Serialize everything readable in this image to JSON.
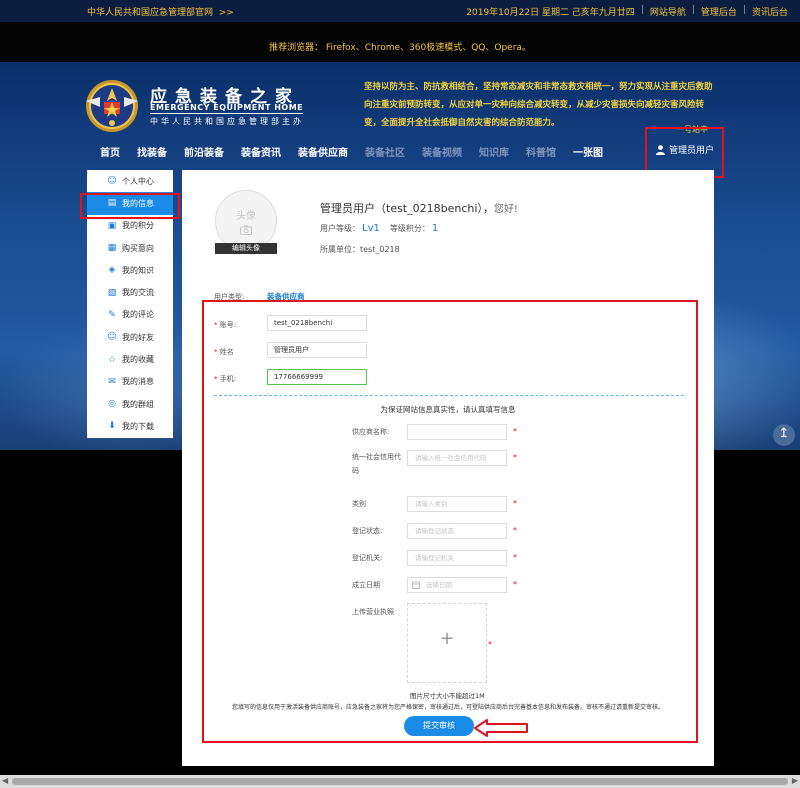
{
  "topbar": {
    "ministry": "中华人民共和国应急管理部官网",
    "ministry_arrow": ">>",
    "date": "2019年10月22日 星期二 己亥年九月廿四",
    "links": [
      "网站导航",
      "管理后台",
      "资讯后台"
    ],
    "sep": "|"
  },
  "browsers": "推荐浏览器： Firefox、Chrome、360极速模式、QQ、Opera。",
  "brand": {
    "title": "应急装备之家",
    "en": "EMERGENCY EQUIPMENT HOME",
    "sub": "中华人民共和国应急管理部主办"
  },
  "slogan": "坚持以防为主、防抗救相结合，坚持常态减灾和非常态救灾相统一，努力实现从注重灾后救助向注重灾前预防转变，从应对单一灾种向综合减灾转变，从减少灾害损失向减轻灾害风险转变，全面提升全社会抵御自然灾害的综合防范能力。",
  "tag": "一号站中",
  "nav": {
    "items": [
      "首页",
      "找装备",
      "前沿装备",
      "装备资讯",
      "装备供应商"
    ],
    "dim_items": [
      "装备社区",
      "装备视频",
      "知识库",
      "科普馆"
    ],
    "extra": "一张图",
    "user": "管理员用户"
  },
  "sidebar": {
    "items": [
      {
        "label": "个人中心",
        "icon": "user-icon"
      },
      {
        "label": "我的信息",
        "icon": "profile-icon"
      },
      {
        "label": "我的积分",
        "icon": "points-icon"
      },
      {
        "label": "购买意向",
        "icon": "cart-icon"
      },
      {
        "label": "我的知识",
        "icon": "knowledge-icon"
      },
      {
        "label": "我的交流",
        "icon": "chat-icon"
      },
      {
        "label": "我的评论",
        "icon": "comment-icon"
      },
      {
        "label": "我的好友",
        "icon": "friends-icon"
      },
      {
        "label": "我的收藏",
        "icon": "star-icon"
      },
      {
        "label": "我的消息",
        "icon": "message-icon"
      },
      {
        "label": "我的群组",
        "icon": "group-icon"
      },
      {
        "label": "我的下载",
        "icon": "download-icon"
      }
    ],
    "active_index": 1
  },
  "profile": {
    "avatar_label": "头像",
    "edit_avatar": "编辑头像",
    "greeting_name": "管理员用户（test_0218benchi），",
    "greeting_hi": "您好!",
    "level_label": "用户等级：",
    "level_value": "Lv1",
    "points_label": "等级积分：",
    "points_value": "1",
    "unit_label": "所属单位：",
    "unit_value": "test_0218"
  },
  "form": {
    "user_type_label": "用户类型:",
    "user_type_value": "装备供应商",
    "account_label": "账号:",
    "account_value": "test_0218benchi",
    "name_label": "姓名",
    "name_value": "管理员用户",
    "phone_label": "手机:",
    "phone_value": "17766669999",
    "notice": "为保证网站信息真实性，请认真填写信息",
    "supplier_name_label": "供应商名称:",
    "credit_code_label": "统一社会信用代码",
    "credit_code_placeholder": "请输入统一社会信用代码",
    "category_label": "类别",
    "category_placeholder": "请输入类别",
    "reg_status_label": "登记状态:",
    "reg_status_placeholder": "请输登记状态",
    "reg_org_label": "登记机关:",
    "reg_org_placeholder": "请输登记机关",
    "founded_label": "成立日期",
    "founded_placeholder": "选择日期",
    "license_label": "上传营业执照",
    "img_tip": "图片尺寸大小不能超过1M",
    "disclaimer": "您填写的信息仅用于激活装备供应商账号，应急装备之家将为您严格保密，审核通过后，可登陆供应商后台完善基本信息和发布装备。审核不通过请重新提交审核。",
    "submit_label": "提交审核",
    "required_mark": "*"
  }
}
